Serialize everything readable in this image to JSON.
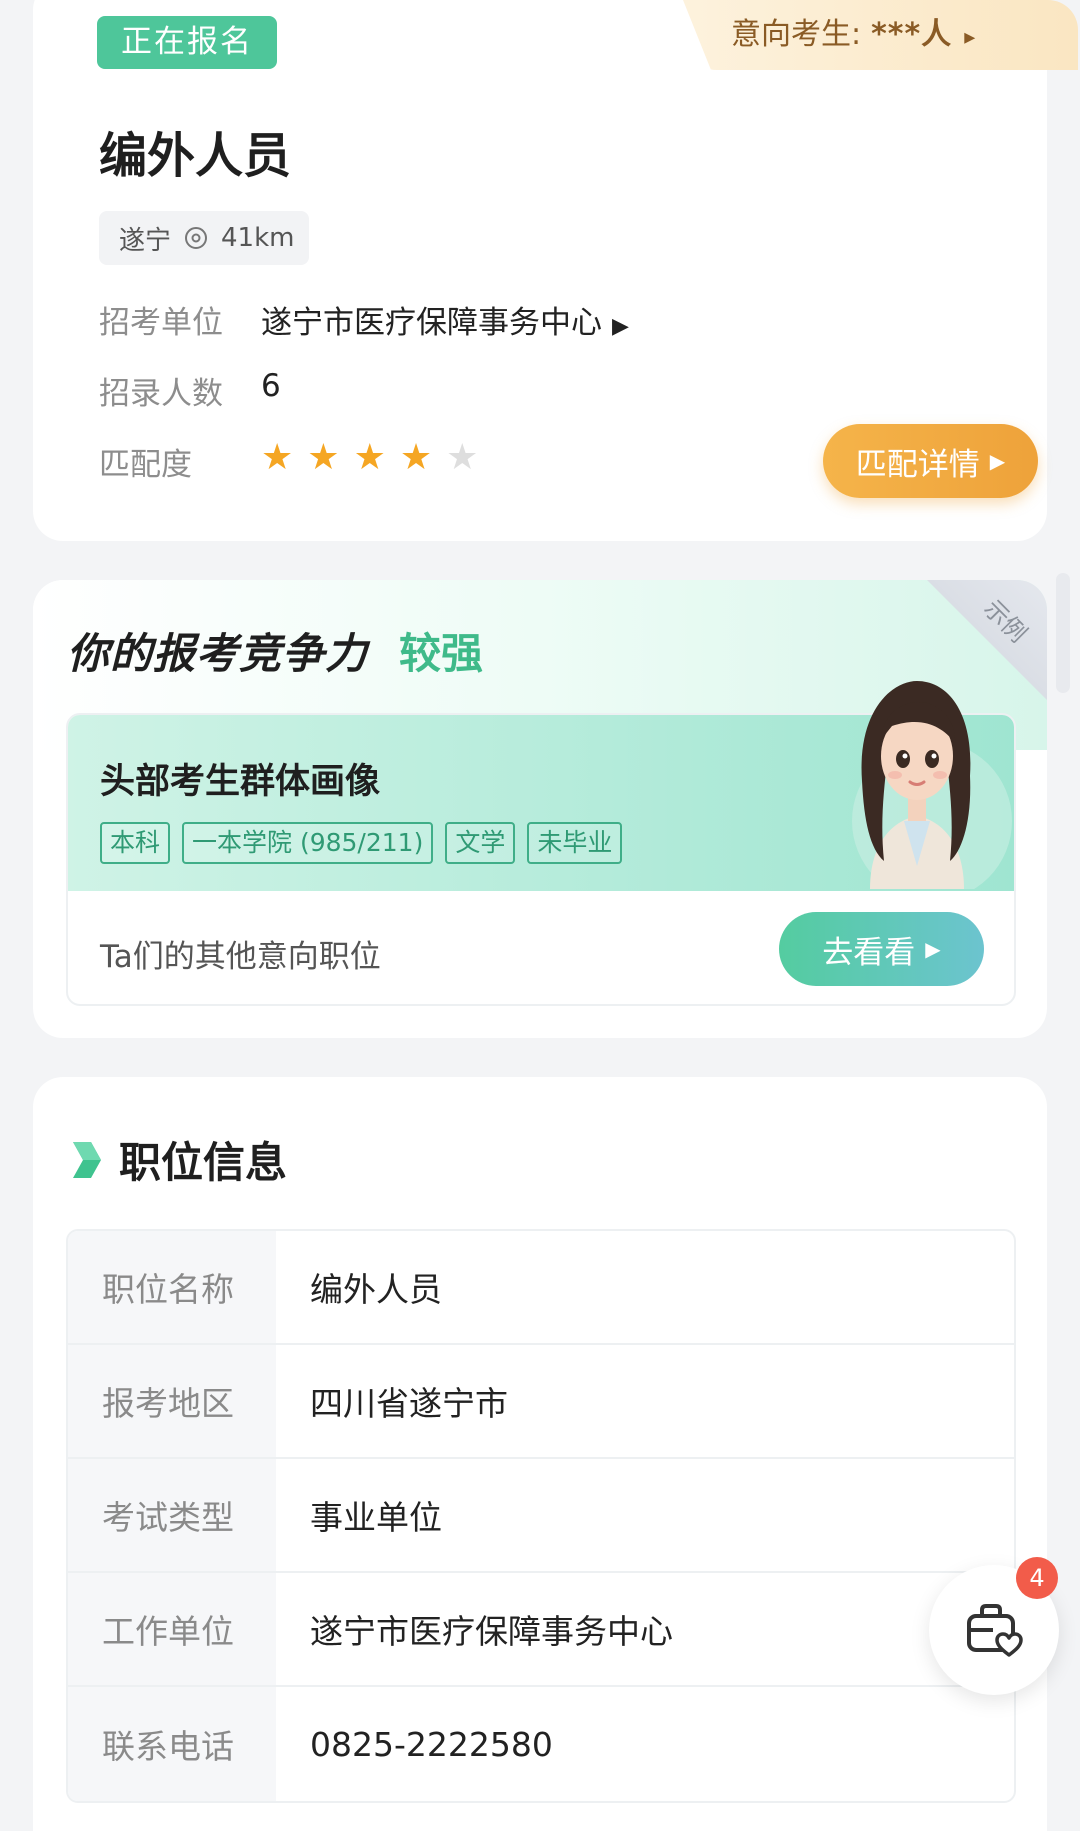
{
  "card_header": {
    "status_badge": "正在报名",
    "intent_label": "意向考生:",
    "intent_value": "***人",
    "intent_arrow": "▸"
  },
  "job": {
    "title": "编外人员",
    "location": "遂宁",
    "distance": "41km",
    "employer_label": "招考单位",
    "employer_value": "遂宁市医疗保障事务中心",
    "headcount_label": "招录人数",
    "headcount_value": "6",
    "match_label": "匹配度",
    "match_rating": 4,
    "match_rating_max": 5,
    "match_button": "匹配详情"
  },
  "competitiveness": {
    "title": "你的报考竞争力",
    "level": "较强",
    "example_corner": "示例",
    "portrait_title": "头部考生群体画像",
    "tags": [
      "本科",
      "一本学院 (985/211)",
      "文学",
      "未毕业"
    ],
    "others_label": "Ta们的其他意向职位",
    "go_button": "去看看"
  },
  "position_info": {
    "section_title": "职位信息",
    "rows": [
      {
        "key": "职位名称",
        "value": "编外人员"
      },
      {
        "key": "报考地区",
        "value": "四川省遂宁市"
      },
      {
        "key": "考试类型",
        "value": "事业单位"
      },
      {
        "key": "工作单位",
        "value": "遂宁市医疗保障事务中心"
      },
      {
        "key": "联系电话",
        "value": "0825-2222580"
      }
    ]
  },
  "fab": {
    "badge_count": "4",
    "icon": "briefcase-heart-icon"
  },
  "colors": {
    "status_green": "#4ec69a",
    "match_orange": "#eea23a",
    "accent_green": "#3fba8a",
    "badge_red": "#f25c4a"
  }
}
